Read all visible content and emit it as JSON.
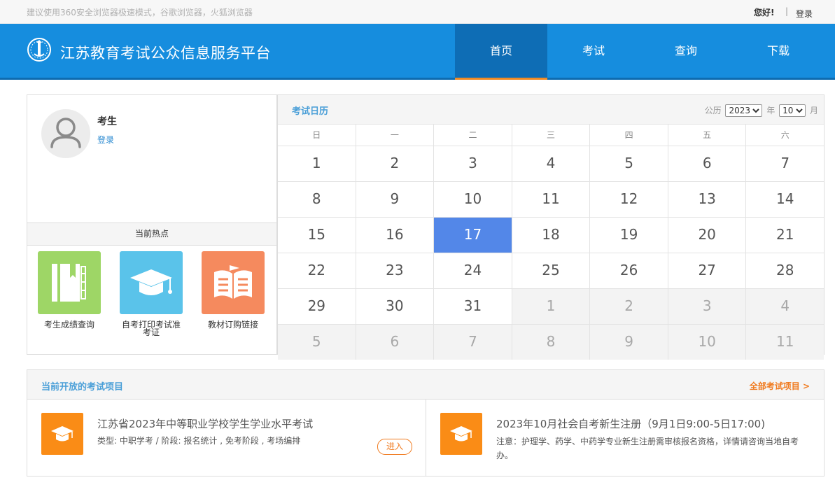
{
  "topbar": {
    "browser_tip": "建议使用360安全浏览器极速模式，谷歌浏览器，火狐浏览器",
    "greeting": "您好!",
    "separator": "|",
    "login": "登录"
  },
  "header": {
    "site_title": "江苏教育考试公众信息服务平台",
    "nav": [
      {
        "label": "首页",
        "active": true
      },
      {
        "label": "考试",
        "active": false
      },
      {
        "label": "查询",
        "active": false
      },
      {
        "label": "下载",
        "active": false
      }
    ]
  },
  "user": {
    "name": "考生",
    "login_link": "登录"
  },
  "hot": {
    "title": "当前热点",
    "items": [
      {
        "label": "考生成绩查询",
        "color": "#9ed666",
        "icon": "notebook-icon"
      },
      {
        "label": "自考打印考试准考证",
        "color": "#5ac3ea",
        "icon": "graduation-cap-icon"
      },
      {
        "label": "教材订购链接",
        "color": "#f58a5e",
        "icon": "open-book-icon"
      }
    ]
  },
  "calendar": {
    "title": "考试日历",
    "era_label": "公历",
    "year": "2023",
    "year_unit": "年",
    "month": "10",
    "month_unit": "月",
    "weekdays": [
      "日",
      "一",
      "二",
      "三",
      "四",
      "五",
      "六"
    ],
    "today": "17",
    "weeks": [
      [
        {
          "d": "1"
        },
        {
          "d": "2"
        },
        {
          "d": "3"
        },
        {
          "d": "4"
        },
        {
          "d": "5"
        },
        {
          "d": "6"
        },
        {
          "d": "7"
        }
      ],
      [
        {
          "d": "8"
        },
        {
          "d": "9"
        },
        {
          "d": "10"
        },
        {
          "d": "11"
        },
        {
          "d": "12"
        },
        {
          "d": "13"
        },
        {
          "d": "14"
        }
      ],
      [
        {
          "d": "15"
        },
        {
          "d": "16"
        },
        {
          "d": "17",
          "today": true
        },
        {
          "d": "18"
        },
        {
          "d": "19"
        },
        {
          "d": "20"
        },
        {
          "d": "21"
        }
      ],
      [
        {
          "d": "22"
        },
        {
          "d": "23"
        },
        {
          "d": "24"
        },
        {
          "d": "25"
        },
        {
          "d": "26"
        },
        {
          "d": "27"
        },
        {
          "d": "28"
        }
      ],
      [
        {
          "d": "29"
        },
        {
          "d": "30"
        },
        {
          "d": "31"
        },
        {
          "d": "1",
          "other": true
        },
        {
          "d": "2",
          "other": true
        },
        {
          "d": "3",
          "other": true
        },
        {
          "d": "4",
          "other": true
        }
      ],
      [
        {
          "d": "5",
          "other": true
        },
        {
          "d": "6",
          "other": true
        },
        {
          "d": "7",
          "other": true
        },
        {
          "d": "8",
          "other": true
        },
        {
          "d": "9",
          "other": true
        },
        {
          "d": "10",
          "other": true
        },
        {
          "d": "11",
          "other": true
        }
      ]
    ]
  },
  "projects": {
    "title": "当前开放的考试项目",
    "all_link": "全部考试项目 >",
    "items": [
      {
        "name": "江苏省2023年中等职业学校学生学业水平考试",
        "sub": "类型:  中职学考 / 阶段:  报名统计 , 免考阶段 , 考场编排",
        "button": "进入"
      },
      {
        "name": "2023年10月社会自考新生注册（9月1日9:00-5日17:00)",
        "note": "注意：护理学、药学、中药学专业新生注册需审核报名资格，详情请咨询当地自考办。"
      }
    ]
  },
  "colors": {
    "header_blue": "#168dde",
    "nav_active": "#0e6db5",
    "accent_orange": "#f07a1e",
    "today_blue": "#5387e8",
    "title_blue": "#4a9fd8"
  }
}
